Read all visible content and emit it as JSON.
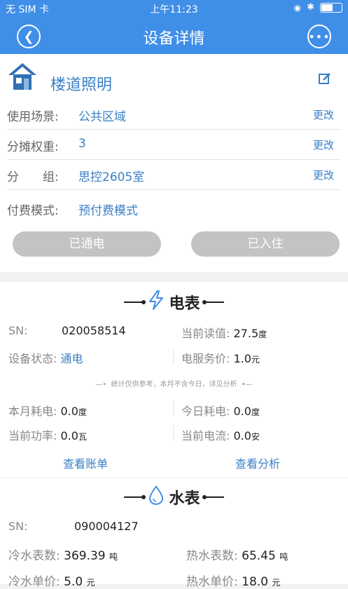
{
  "status": {
    "carrier": "无 SIM 卡",
    "time": "上午11:23"
  },
  "nav": {
    "title": "设备详情"
  },
  "device": {
    "name": "楼道照明",
    "rows": [
      {
        "label": "使用场景:",
        "value": "公共区域",
        "action": "更改"
      },
      {
        "label": "分摊权重:",
        "value": "3",
        "action": "更改"
      },
      {
        "label": "分　　组:",
        "value": "思控2605室",
        "action": "更改"
      },
      {
        "label": "付费模式:",
        "value": "预付费模式",
        "action": ""
      }
    ],
    "buttons": {
      "power": "已通电",
      "checkin": "已入住"
    }
  },
  "electric": {
    "title": "电表",
    "sn_label": "SN:",
    "sn": "020058514",
    "reading_label": "当前读值:",
    "reading": "27.5",
    "reading_unit": "度",
    "state_label": "设备状态:",
    "state": "通电",
    "fee_label": "电服务价:",
    "fee": "1.0",
    "fee_unit": "元",
    "note": "统计仅供参考，本月不含今日，详见分析",
    "month_label": "本月耗电:",
    "month": "0.0",
    "month_unit": "度",
    "today_label": "今日耗电:",
    "today": "0.0",
    "today_unit": "度",
    "power_label": "当前功率:",
    "power": "0.0",
    "power_unit": "瓦",
    "current_label": "当前电流:",
    "current": "0.0",
    "current_unit": "安",
    "bill_link": "查看账单",
    "analysis_link": "查看分析"
  },
  "water": {
    "title": "水表",
    "sn_label": "SN:",
    "sn": "090004127",
    "cold_label": "冷水表数:",
    "cold": "369.39",
    "cold_unit": "吨",
    "hot_label": "热水表数:",
    "hot": "65.45",
    "hot_unit": "吨",
    "cold_price_label": "冷水单价:",
    "cold_price": "5.0",
    "cold_price_unit": "元",
    "hot_price_label": "热水单价:",
    "hot_price": "18.0",
    "hot_price_unit": "元"
  },
  "colors": {
    "primary": "#3f8ee8",
    "link": "#3a7fc5",
    "pill": "#c3c3c3"
  }
}
